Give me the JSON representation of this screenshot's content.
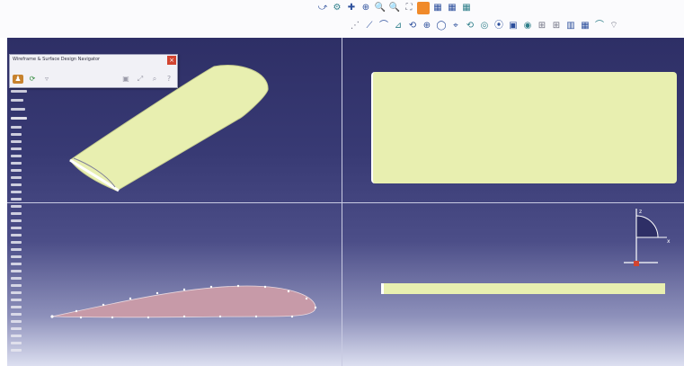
{
  "navigator": {
    "title": "Wireframe & Surface Design Navigator",
    "close_glyph": "×"
  },
  "toolbar": {
    "row1": [
      "⤻",
      "⚙",
      "✚",
      "⊕",
      "🔍",
      "🔍",
      "⛶",
      "■",
      "▦",
      "▦",
      "▦"
    ],
    "row2": [
      "⋰",
      "⟋",
      "⌒",
      "⊿",
      "⟲",
      "⊕",
      "◯",
      "⌖",
      "⟲",
      "◎",
      "⦿",
      "▣",
      "◉",
      "⊞",
      "⊞",
      "▥",
      "▦",
      "⌒",
      "⌔"
    ]
  },
  "colors": {
    "wing_surface": "#e8efb0",
    "profile_fill": "#c79aa8",
    "viewport_top": "#2e2f66",
    "accent_red": "#d24430"
  },
  "compass": {
    "axis_label_z": "z",
    "axis_label_x": "x"
  }
}
